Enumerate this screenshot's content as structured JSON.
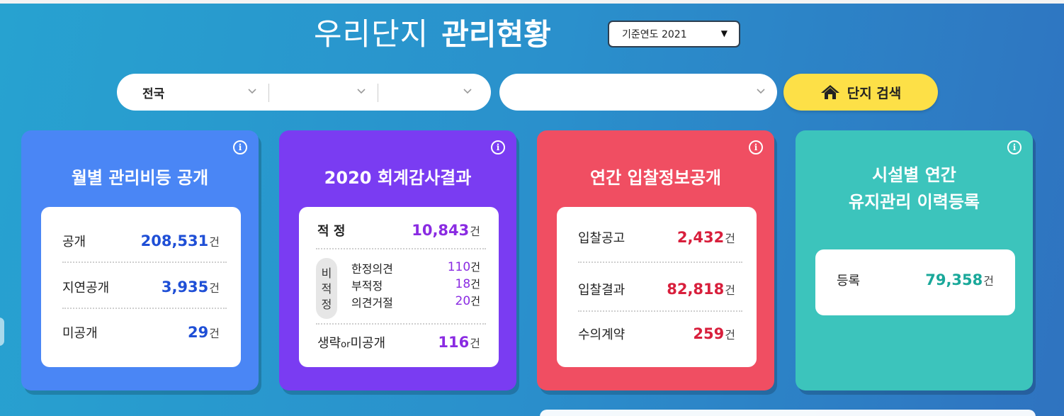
{
  "header": {
    "title_light": "우리단지",
    "title_bold": "관리현황",
    "year_select": "기준연도 2021"
  },
  "search": {
    "region1": "전국",
    "region2": "",
    "region3": "",
    "apartment": "",
    "button_label": "단지 검색"
  },
  "cards": {
    "monthly": {
      "title": "월별 관리비등 공개",
      "rows": [
        {
          "label": "공개",
          "value": "208,531",
          "unit": "건"
        },
        {
          "label": "지연공개",
          "value": "3,935",
          "unit": "건"
        },
        {
          "label": "미공개",
          "value": "29",
          "unit": "건"
        }
      ]
    },
    "audit": {
      "title": "2020 회계감사결과",
      "proper": {
        "label": "적 정",
        "value": "10,843",
        "unit": "건"
      },
      "nonproper_label": [
        "비",
        "적",
        "정"
      ],
      "nonproper": [
        {
          "label": "한정의견",
          "value": "110",
          "unit": "건"
        },
        {
          "label": "부적정",
          "value": "18",
          "unit": "건"
        },
        {
          "label": "의견거절",
          "value": "20",
          "unit": "건"
        }
      ],
      "omitted": {
        "label_a": "생략",
        "label_or": "or",
        "label_b": "미공개",
        "value": "116",
        "unit": "건"
      }
    },
    "bid": {
      "title": "연간 입찰정보공개",
      "rows": [
        {
          "label": "입찰공고",
          "value": "2,432",
          "unit": "건"
        },
        {
          "label": "입찰결과",
          "value": "82,818",
          "unit": "건"
        },
        {
          "label": "수의계약",
          "value": "259",
          "unit": "건"
        }
      ]
    },
    "facility": {
      "title_line1": "시설별 연간",
      "title_line2": "유지관리 이력등록",
      "row": {
        "label": "등록",
        "value": "79,358",
        "unit": "건"
      }
    }
  }
}
